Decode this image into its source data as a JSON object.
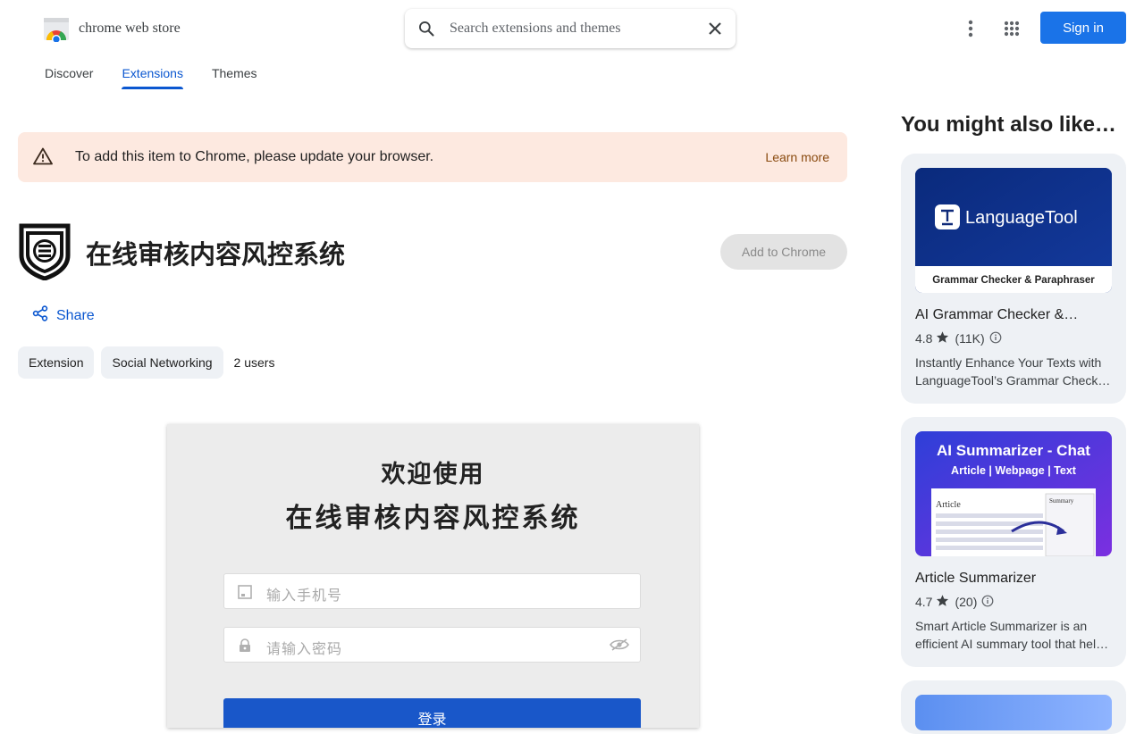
{
  "header": {
    "logo_text": "chrome web store",
    "search_placeholder": "Search extensions and themes",
    "sign_in_label": "Sign in"
  },
  "nav": {
    "tabs": [
      {
        "label": "Discover",
        "active": false
      },
      {
        "label": "Extensions",
        "active": true
      },
      {
        "label": "Themes",
        "active": false
      }
    ]
  },
  "banner": {
    "message": "To add this item to Chrome, please update your browser.",
    "link": "Learn more",
    "icon": "warning-icon"
  },
  "extension": {
    "title": "在线审核内容风控系统",
    "add_label": "Add to Chrome",
    "share_label": "Share",
    "chips": [
      "Extension",
      "Social Networking"
    ],
    "users": "2 users"
  },
  "screenshot": {
    "welcome": "欢迎使用",
    "system_name": "在线审核内容风控系统",
    "phone_placeholder": "输入手机号",
    "password_placeholder": "请输入密码",
    "login_label": "登录"
  },
  "aside": {
    "title": "You might also like…",
    "cards": [
      {
        "name": "AI Grammar Checker &…",
        "rating": "4.8",
        "count": "(11K)",
        "desc_line1": "Instantly Enhance Your Texts with",
        "desc_line2": "LanguageTool’s Grammar Check…",
        "img_title": "LanguageTool",
        "img_subtitle": "Grammar Checker & Paraphraser"
      },
      {
        "name": "Article Summarizer",
        "rating": "4.7",
        "count": "(20)",
        "desc_line1": "Smart Article Summarizer is an",
        "desc_line2": "efficient AI summary tool that hel…",
        "img_title": "AI Summarizer - Chat",
        "img_subtitle": "Article | Webpage | Text",
        "img_doc_label": "Article",
        "img_summary_label": "Summary"
      }
    ]
  },
  "colors": {
    "accent": "#0b57d0",
    "sign_in_bg": "#1a73e8",
    "banner_bg": "#fde9e0"
  }
}
